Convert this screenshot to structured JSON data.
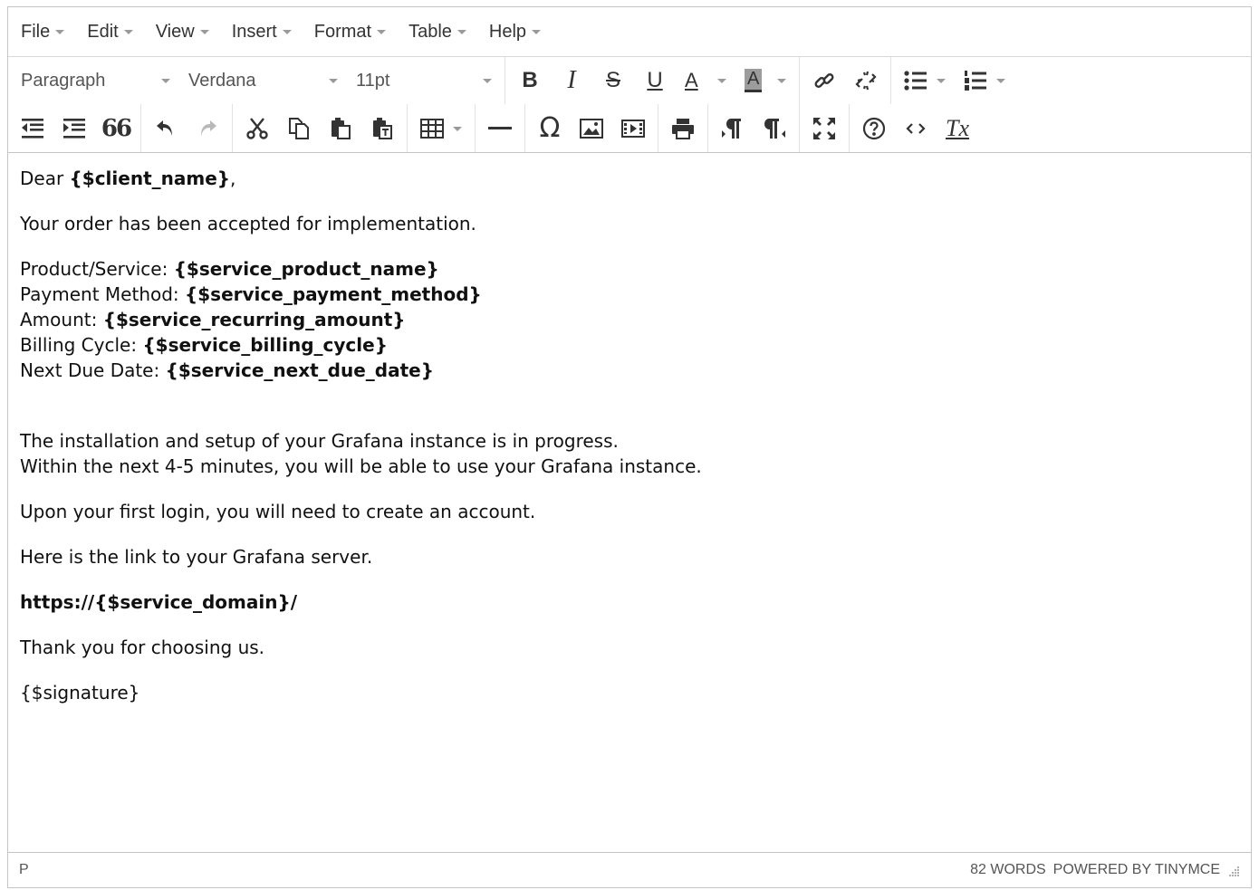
{
  "menubar": {
    "items": [
      "File",
      "Edit",
      "View",
      "Insert",
      "Format",
      "Table",
      "Help"
    ]
  },
  "toolbar": {
    "block_format": "Paragraph",
    "font_family": "Verdana",
    "font_size": "11pt",
    "bold_label": "B",
    "italic_label": "I",
    "strike_label": "S",
    "underline_label": "U",
    "forecolor_label": "A",
    "backcolor_label": "A",
    "quote_label": "66",
    "omega_label": "Ω",
    "clear_format_label": "Tx"
  },
  "content": {
    "greeting_prefix": "Dear ",
    "greeting_var": "{$client_name}",
    "greeting_suffix": ",",
    "line_accepted": "Your order has been accepted for implementation.",
    "details": [
      {
        "label": "Product/Service: ",
        "value": "{$service_product_name}"
      },
      {
        "label": "Payment Method: ",
        "value": "{$service_payment_method}"
      },
      {
        "label": "Amount: ",
        "value": "{$service_recurring_amount}"
      },
      {
        "label": "Billing Cycle: ",
        "value": "{$service_billing_cycle}"
      },
      {
        "label": "Next Due Date: ",
        "value": "{$service_next_due_date}"
      }
    ],
    "install_line1": "The installation and setup of your Grafana instance is in progress.",
    "install_line2": "Within the next 4-5 minutes, you will be able to use your Grafana instance.",
    "login_line": "Upon your first login, you will need to create an account.",
    "link_intro": "Here is the link to your Grafana server.",
    "link_url": "https://{$service_domain}/",
    "thanks": "Thank you for choosing us.",
    "signature": "{$signature}"
  },
  "statusbar": {
    "path": "P",
    "wordcount": "82 WORDS",
    "powered": "POWERED BY TINYMCE"
  }
}
